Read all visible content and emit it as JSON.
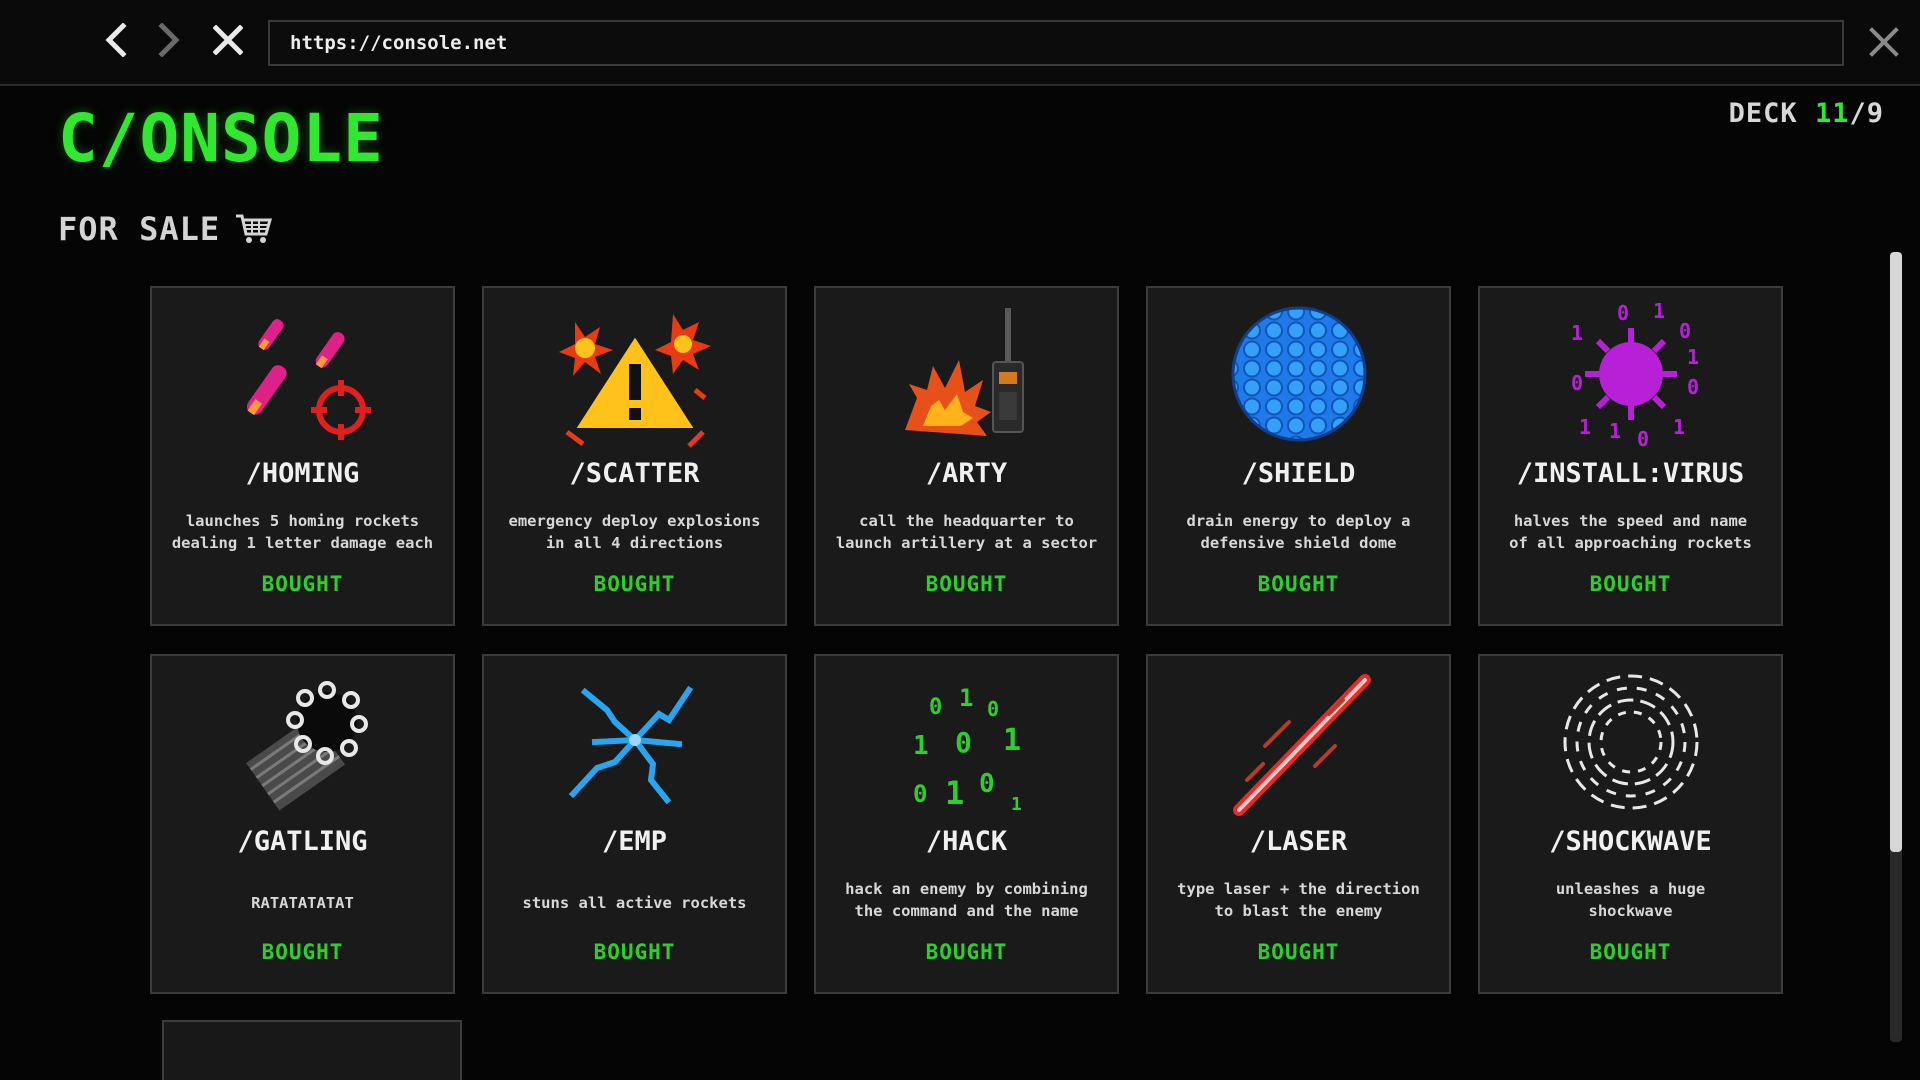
{
  "browser": {
    "url": "https://console.net",
    "back_icon": "chevron-left-icon",
    "forward_icon": "chevron-right-icon",
    "stop_icon": "close-icon",
    "close_icon": "close-icon"
  },
  "logo": "C/ONSOLE",
  "deck": {
    "label": "DECK",
    "current": "11",
    "separator": "/",
    "max": "9"
  },
  "section": {
    "label": "FOR SALE",
    "icon": "cart-icon"
  },
  "cards": [
    {
      "icon": "homing-rockets-icon",
      "title": "/HOMING",
      "desc": "launches 5 homing rockets\ndealing 1 letter damage each",
      "status": "BOUGHT"
    },
    {
      "icon": "warning-explosion-icon",
      "title": "/SCATTER",
      "desc": "emergency deploy explosions\nin all 4 directions",
      "status": "BOUGHT"
    },
    {
      "icon": "artillery-radio-icon",
      "title": "/ARTY",
      "desc": "call the headquarter to\nlaunch artillery at a sector",
      "status": "BOUGHT"
    },
    {
      "icon": "shield-dome-icon",
      "title": "/SHIELD",
      "desc": "drain energy to deploy a\ndefensive shield dome",
      "status": "BOUGHT"
    },
    {
      "icon": "virus-icon",
      "title": "/INSTALL:VIRUS",
      "desc": "halves the speed and name\nof all approaching rockets",
      "status": "BOUGHT"
    },
    {
      "icon": "gatling-gun-icon",
      "title": "/GATLING",
      "desc": "RATATATATAT",
      "status": "BOUGHT"
    },
    {
      "icon": "emp-spark-icon",
      "title": "/EMP",
      "desc": "stuns all active rockets",
      "status": "BOUGHT"
    },
    {
      "icon": "binary-code-icon",
      "title": "/HACK",
      "desc": "hack an enemy by combining\nthe command and the name",
      "status": "BOUGHT"
    },
    {
      "icon": "laser-beam-icon",
      "title": "/LASER",
      "desc": "type laser + the direction\nto blast the enemy",
      "status": "BOUGHT"
    },
    {
      "icon": "shockwave-rings-icon",
      "title": "/SHOCKWAVE",
      "desc": "unleashes a huge\nshockwave",
      "status": "BOUGHT"
    }
  ],
  "colors": {
    "accent_green": "#2fe82f",
    "status_green": "#2ccf2c",
    "card_bg": "#1a1a1a",
    "page_bg": "#050505"
  }
}
